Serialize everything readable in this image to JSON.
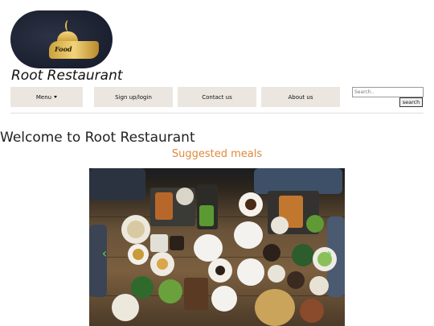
{
  "header": {
    "logo_alt_text": "Food",
    "logo_color": "#1b2030",
    "site_title": "Root Restaurant"
  },
  "nav": {
    "menu_label": "Menu",
    "signup_label": "Sign up/login",
    "contact_label": "Contact us",
    "about_label": "About us",
    "button_bg": "#ebe6e0"
  },
  "search": {
    "placeholder": "Search..",
    "button_label": "search"
  },
  "main": {
    "welcome_heading": "Welcome to Root Restaurant",
    "suggested_heading": "Suggested meals",
    "suggested_color": "#e0893c",
    "carousel": {
      "prev_icon": "chevron-left-icon",
      "next_icon": "chevron-right-icon",
      "prev_glyph": "‹",
      "next_glyph": "›",
      "arrow_color": "#5fd34a"
    }
  }
}
